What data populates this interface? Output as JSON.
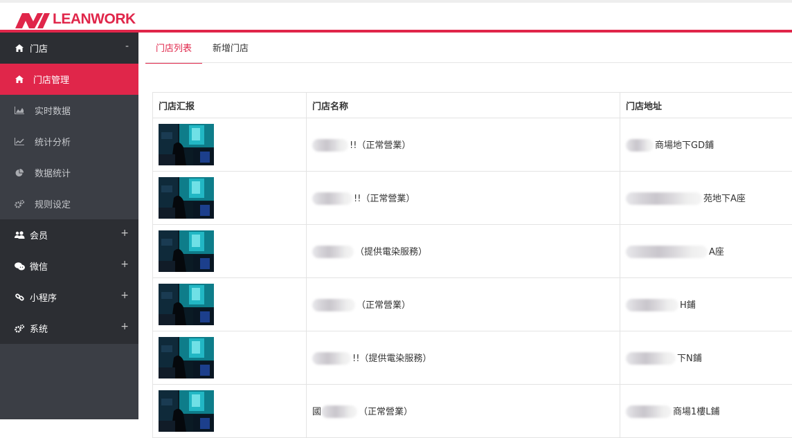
{
  "brand": {
    "name": "LEANWORK",
    "color": "#e0264a"
  },
  "sidebar": {
    "groups": [
      {
        "label": "门店",
        "icon": "home-icon",
        "toggle": "-",
        "items": [
          {
            "label": "门店管理",
            "icon": "home-icon",
            "active": true
          },
          {
            "label": "实时数据",
            "icon": "area-chart-icon"
          },
          {
            "label": "统计分析",
            "icon": "line-chart-icon"
          },
          {
            "label": "数据统计",
            "icon": "pie-chart-icon"
          },
          {
            "label": "规则设定",
            "icon": "cogs-icon"
          }
        ]
      },
      {
        "label": "会员",
        "icon": "users-icon",
        "toggle": "+"
      },
      {
        "label": "微信",
        "icon": "wechat-icon",
        "toggle": "+"
      },
      {
        "label": "小程序",
        "icon": "link-icon",
        "toggle": "+"
      },
      {
        "label": "系统",
        "icon": "cogs-icon",
        "toggle": "+"
      }
    ]
  },
  "tabs": [
    {
      "label": "门店列表",
      "active": true
    },
    {
      "label": "新增门店",
      "active": false
    }
  ],
  "table": {
    "headers": [
      "门店汇报",
      "门店名称",
      "门店地址"
    ],
    "rows": [
      {
        "name_prefix": "",
        "name_suffix": "!!（正常營業）",
        "addr_prefix": "",
        "addr_suffix": "商場地下GD鋪"
      },
      {
        "name_prefix": "",
        "name_suffix": "!!（正常營業）",
        "addr_prefix": "",
        "addr_suffix": "苑地下A座"
      },
      {
        "name_prefix": "",
        "name_suffix": "（提供電染服務）",
        "addr_prefix": "",
        "addr_suffix": "A座"
      },
      {
        "name_prefix": "",
        "name_suffix": "（正常營業）",
        "addr_prefix": "",
        "addr_suffix": "H鋪"
      },
      {
        "name_prefix": "",
        "name_suffix": "!!（提供電染服務）",
        "addr_prefix": "",
        "addr_suffix": "下N鋪"
      },
      {
        "name_prefix": "國",
        "name_suffix": "（正常營業）",
        "addr_prefix": "",
        "addr_suffix": "商場1樓L鋪"
      }
    ]
  }
}
